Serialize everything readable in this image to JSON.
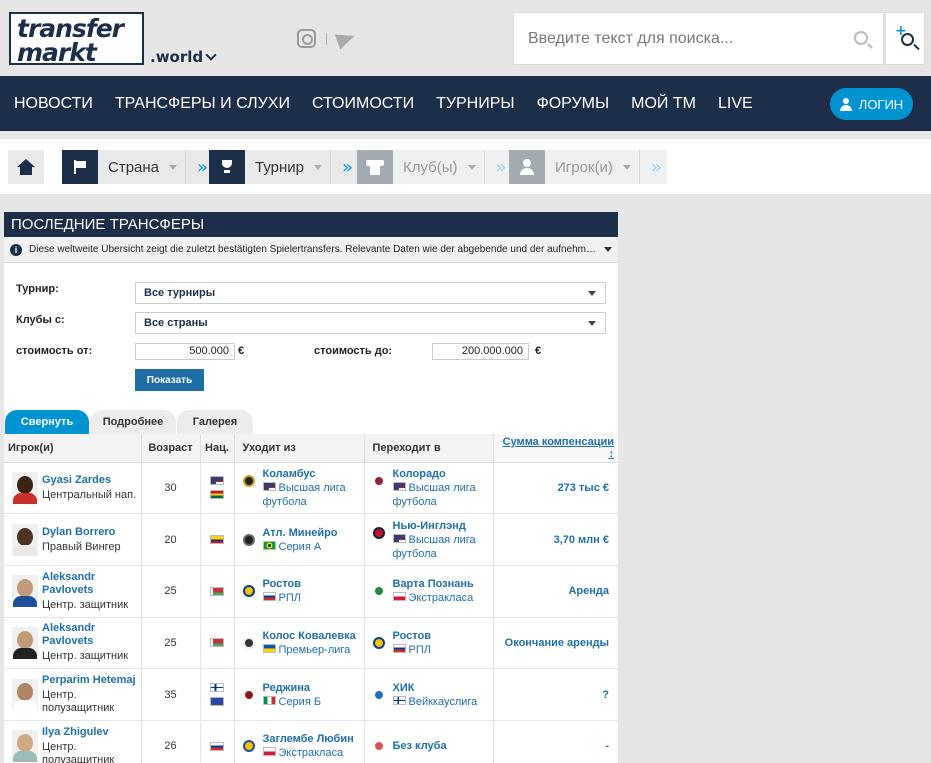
{
  "header": {
    "logo_line1": "transfer",
    "logo_line2": "markt",
    "site_suffix": ".world",
    "search_placeholder": "Введите текст для поиска..."
  },
  "nav": {
    "items": [
      "НОВОСТИ",
      "ТРАНСФЕРЫ И СЛУХИ",
      "СТОИМОСТИ",
      "ТУРНИРЫ",
      "ФОРУМЫ",
      "МОЙ TM",
      "LIVE"
    ],
    "login_label": "ЛОГИН"
  },
  "quick_select": {
    "country": "Страна",
    "competition": "Турнир",
    "club": "Клуб(ы)",
    "player": "Игрок(и)"
  },
  "box": {
    "title": "ПОСЛЕДНИЕ ТРАНСФЕРЫ",
    "info": "Diese weltweite Übersicht zeigt die zuletzt bestätigten Spielertransfers. Relevante Daten wie der abgebende und der aufnehmende Verein sow..."
  },
  "filters": {
    "competition_label": "Турнир:",
    "competition_value": "Все турниры",
    "clubs_label": "Клубы с:",
    "clubs_value": "Все страны",
    "value_from_label": "стоимость от:",
    "value_from": "500.000",
    "value_to_label": "стоимость до:",
    "value_to": "200.000.000",
    "currency": "€",
    "show_button": "Показать"
  },
  "tabs": [
    "Свернуть",
    "Подробнее",
    "Галерея"
  ],
  "table": {
    "headers": [
      "Игрок(и)",
      "Возраст",
      "Нац.",
      "Уходит из",
      "Переходит в",
      "Сумма компенсации ↕"
    ],
    "rows": [
      {
        "name": "Gyasi Zardes",
        "pos": "Центральный нап.",
        "age": "30",
        "flags": [
          "us",
          "gh"
        ],
        "from_club": "Коламбус",
        "from_league": "Высшая лига футбола",
        "from_flag": "us",
        "to_club": "Колорадо",
        "to_league": "Высшая лига футбола",
        "to_flag": "us",
        "fee": "273 тыс €"
      },
      {
        "name": "Dylan Borrero",
        "pos": "Правый Вингер",
        "age": "20",
        "flags": [
          "co"
        ],
        "from_club": "Атл. Минейро",
        "from_league": "Серия А",
        "from_flag": "br",
        "to_club": "Нью-Инглэнд",
        "to_league": "Высшая лига футбола",
        "to_flag": "us",
        "fee": "3,70 млн €"
      },
      {
        "name": "Aleksandr Pavlovets",
        "pos": "Центр. защитник",
        "age": "25",
        "flags": [
          "by"
        ],
        "from_club": "Ростов",
        "from_league": "РПЛ",
        "from_flag": "ru",
        "to_club": "Варта Познань",
        "to_league": "Экстракласа",
        "to_flag": "pl",
        "fee": "Аренда"
      },
      {
        "name": "Aleksandr Pavlovets",
        "pos": "Центр. защитник",
        "age": "25",
        "flags": [
          "by"
        ],
        "from_club": "Колос Ковалевка",
        "from_league": "Премьер-лига",
        "from_flag": "ua",
        "to_club": "Ростов",
        "to_league": "РПЛ",
        "to_flag": "ru",
        "fee": "Окончание аренды"
      },
      {
        "name": "Perparim Hetemaj",
        "pos": "Центр. полузащитник",
        "age": "35",
        "flags": [
          "fi",
          "xk"
        ],
        "from_club": "Реджина",
        "from_league": "Серия Б",
        "from_flag": "it",
        "to_club": "ХИК",
        "to_league": "Вейккауслига",
        "to_flag": "fi",
        "fee": "?"
      },
      {
        "name": "Ilya Zhigulev",
        "pos": "Центр. полузащитник",
        "age": "26",
        "flags": [
          "ru"
        ],
        "from_club": "Заглембе Любин",
        "from_league": "Экстракласа",
        "from_flag": "pl",
        "to_club": "Без клуба",
        "to_league": "",
        "to_flag": "",
        "fee": "-"
      }
    ]
  },
  "colors": {
    "navy": "#1d2e48",
    "accent": "#0093d1",
    "link": "#1f6fa6"
  }
}
